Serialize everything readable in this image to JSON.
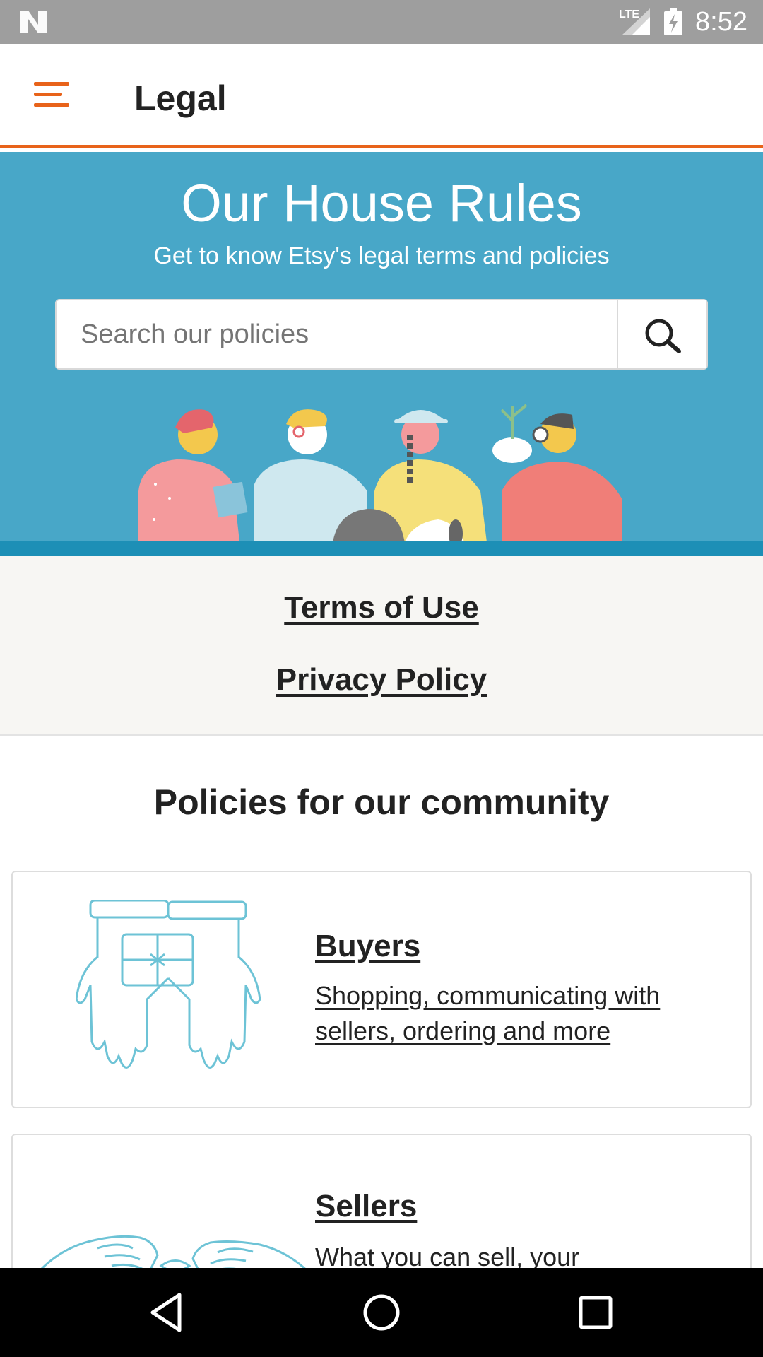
{
  "status_bar": {
    "network": "LTE",
    "time": "8:52"
  },
  "app_bar": {
    "title": "Legal",
    "accent_color": "#e8631a"
  },
  "hero": {
    "title": "Our House Rules",
    "subtitle": "Get to know Etsy's legal terms and policies",
    "background_color": "#48a7c8"
  },
  "search": {
    "placeholder": "Search our policies",
    "value": ""
  },
  "legal_links": {
    "terms": "Terms of Use",
    "privacy": "Privacy Policy"
  },
  "community": {
    "heading": "Policies for our community",
    "cards": [
      {
        "title": "Buyers",
        "description": "Shopping, communicating with sellers, ordering and more",
        "icon": "gift-hands-icon"
      },
      {
        "title": "Sellers",
        "description": "What you can sell, your",
        "icon": "hands-ribbon-icon"
      }
    ]
  },
  "nav_bar": {
    "back_icon": "back-triangle-icon",
    "home_icon": "home-circle-icon",
    "recents_icon": "recents-square-icon"
  }
}
